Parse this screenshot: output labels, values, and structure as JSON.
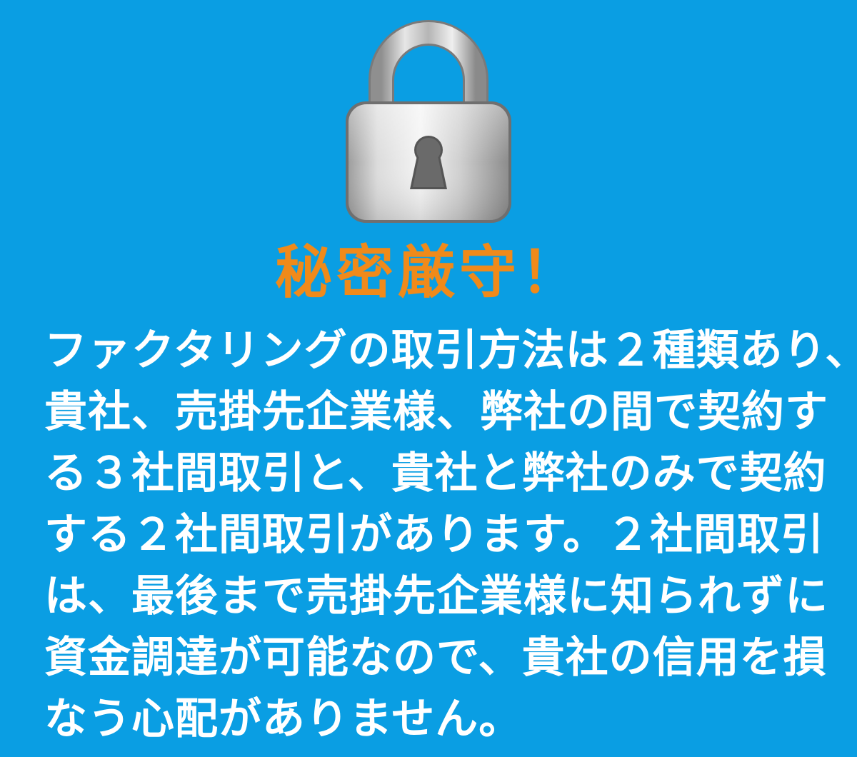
{
  "colors": {
    "background": "#0a9ee3",
    "headline": "#f08a1a",
    "body_text": "#ffffff"
  },
  "icon": "padlock-icon",
  "headline": "秘密厳守！",
  "body_lines": [
    "ファクタリングの取引方法は２種類あり、",
    "貴社、売掛先企業様、弊社の間で契約す",
    "る３社間取引と、貴社と弊社のみで契約",
    "する２社間取引があります。２社間取引",
    "は、最後まで売掛先企業様に知られずに",
    "資金調達が可能なので、貴社の信用を損",
    "なう心配がありません。"
  ]
}
